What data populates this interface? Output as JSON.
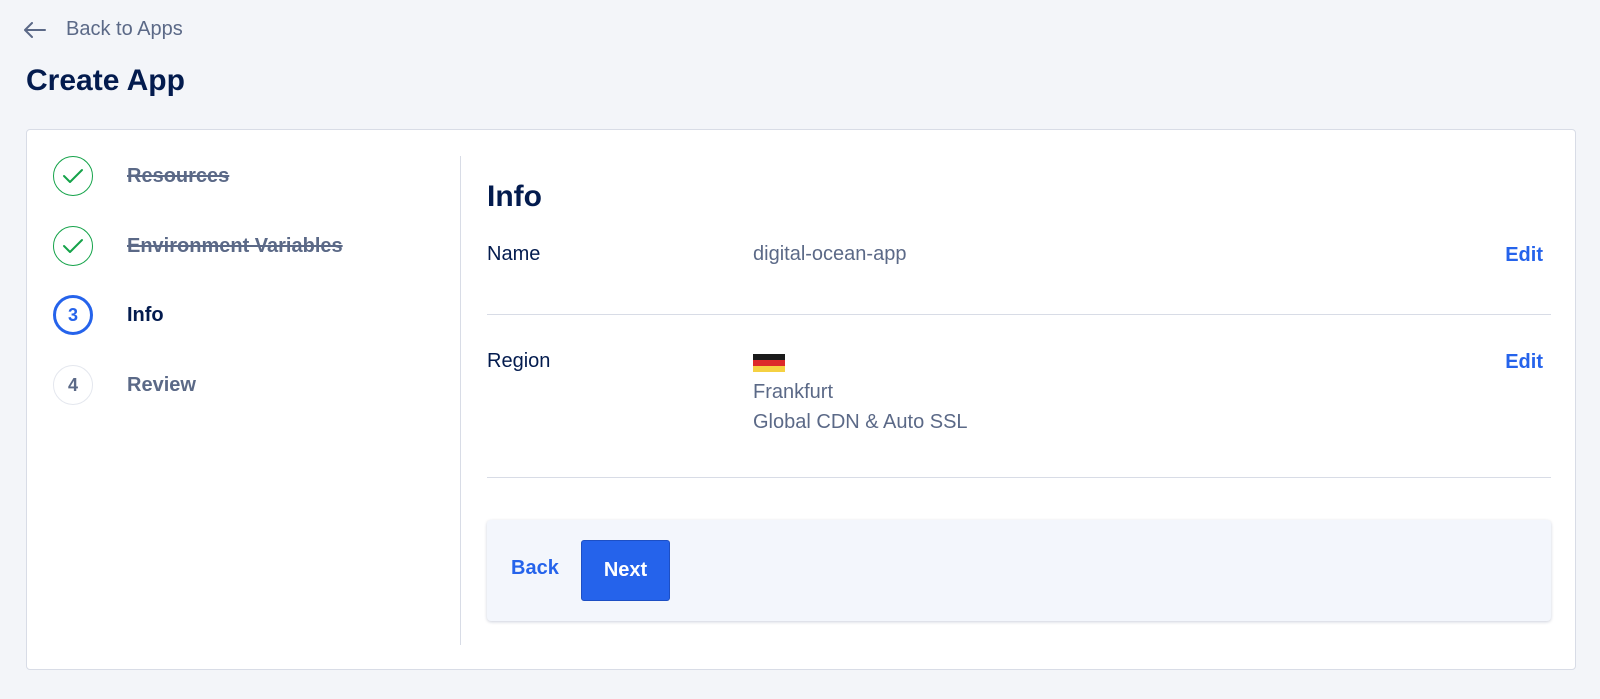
{
  "nav": {
    "back_label": "Back to Apps"
  },
  "page": {
    "title": "Create App"
  },
  "steps": [
    {
      "label": "Resources",
      "state": "done",
      "number": "1"
    },
    {
      "label": "Environment Variables",
      "state": "done",
      "number": "2"
    },
    {
      "label": "Info",
      "state": "current",
      "number": "3"
    },
    {
      "label": "Review",
      "state": "todo",
      "number": "4"
    }
  ],
  "info": {
    "title": "Info",
    "name": {
      "label": "Name",
      "value": "digital-ocean-app",
      "edit_label": "Edit"
    },
    "region": {
      "label": "Region",
      "flag": "germany-flag",
      "city": "Frankfurt",
      "detail": "Global CDN & Auto SSL",
      "edit_label": "Edit"
    }
  },
  "actions": {
    "back_label": "Back",
    "next_label": "Next"
  },
  "colors": {
    "accent": "#2563eb",
    "success": "#15a34a",
    "text": "#031b4e",
    "muted": "#5b6987",
    "background": "#f3f5f9"
  }
}
